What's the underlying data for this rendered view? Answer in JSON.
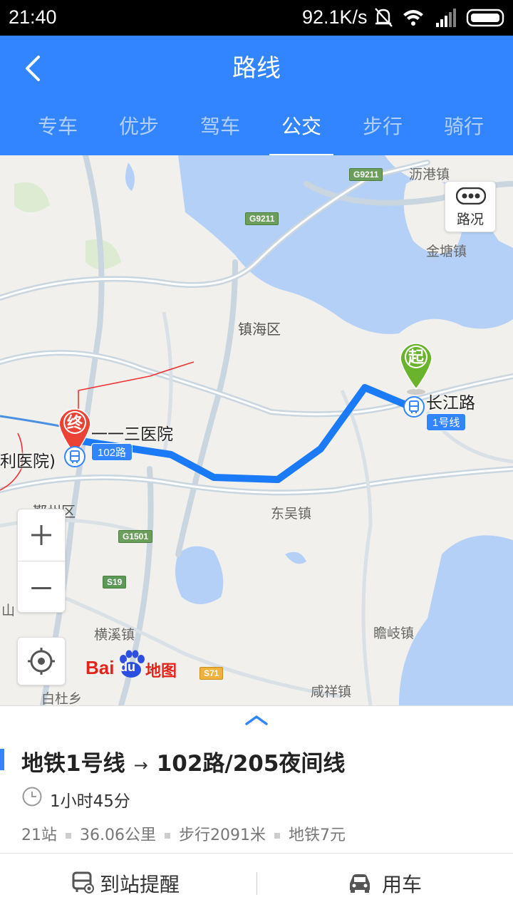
{
  "status_bar": {
    "time": "21:40",
    "net_speed": "92.1K/s"
  },
  "header": {
    "title": "路线",
    "tabs": [
      {
        "label": "专车"
      },
      {
        "label": "优步"
      },
      {
        "label": "驾车"
      },
      {
        "label": "公交",
        "active": true
      },
      {
        "label": "步行"
      },
      {
        "label": "骑行"
      }
    ]
  },
  "map": {
    "traffic_label": "路况",
    "labels": {
      "lijiang": "沥港镇",
      "jintang": "金塘镇",
      "zhenhai": "镇海区",
      "dongwu": "东吴镇",
      "yinzhou": "鄞州区",
      "hengxi": "横溪镇",
      "zhanqi": "瞻岐镇",
      "xianxiang": "咸祥镇",
      "baidu": "白杜乡",
      "shan": "山"
    },
    "highways": {
      "g9211_top": "G9211",
      "g9211_mid": "G9211",
      "g1501": "G1501",
      "s19": "S19",
      "s71": "S71"
    },
    "start_pin": "起",
    "end_pin": "终",
    "start_stop": "长江路",
    "start_line": "1号线",
    "end_stop": "一一三医院",
    "end_stop_left": "利医院)",
    "end_line": "102路",
    "logo": {
      "bai": "Bai",
      "du": "du",
      "ditu": "地图"
    }
  },
  "route": {
    "line1": "地铁1号线",
    "arrow": "→",
    "line2": "102路/205夜间线",
    "duration": "1小时45分",
    "stations": "21站",
    "distance": "36.06公里",
    "walk": "步行2091米",
    "fare": "地铁7元"
  },
  "actions": {
    "reminder": "到站提醒",
    "car": "用车"
  },
  "colors": {
    "header": "#3385ff",
    "route": "#1a7af8",
    "start_pin": "#6ab42d",
    "end_pin": "#ea4335"
  }
}
